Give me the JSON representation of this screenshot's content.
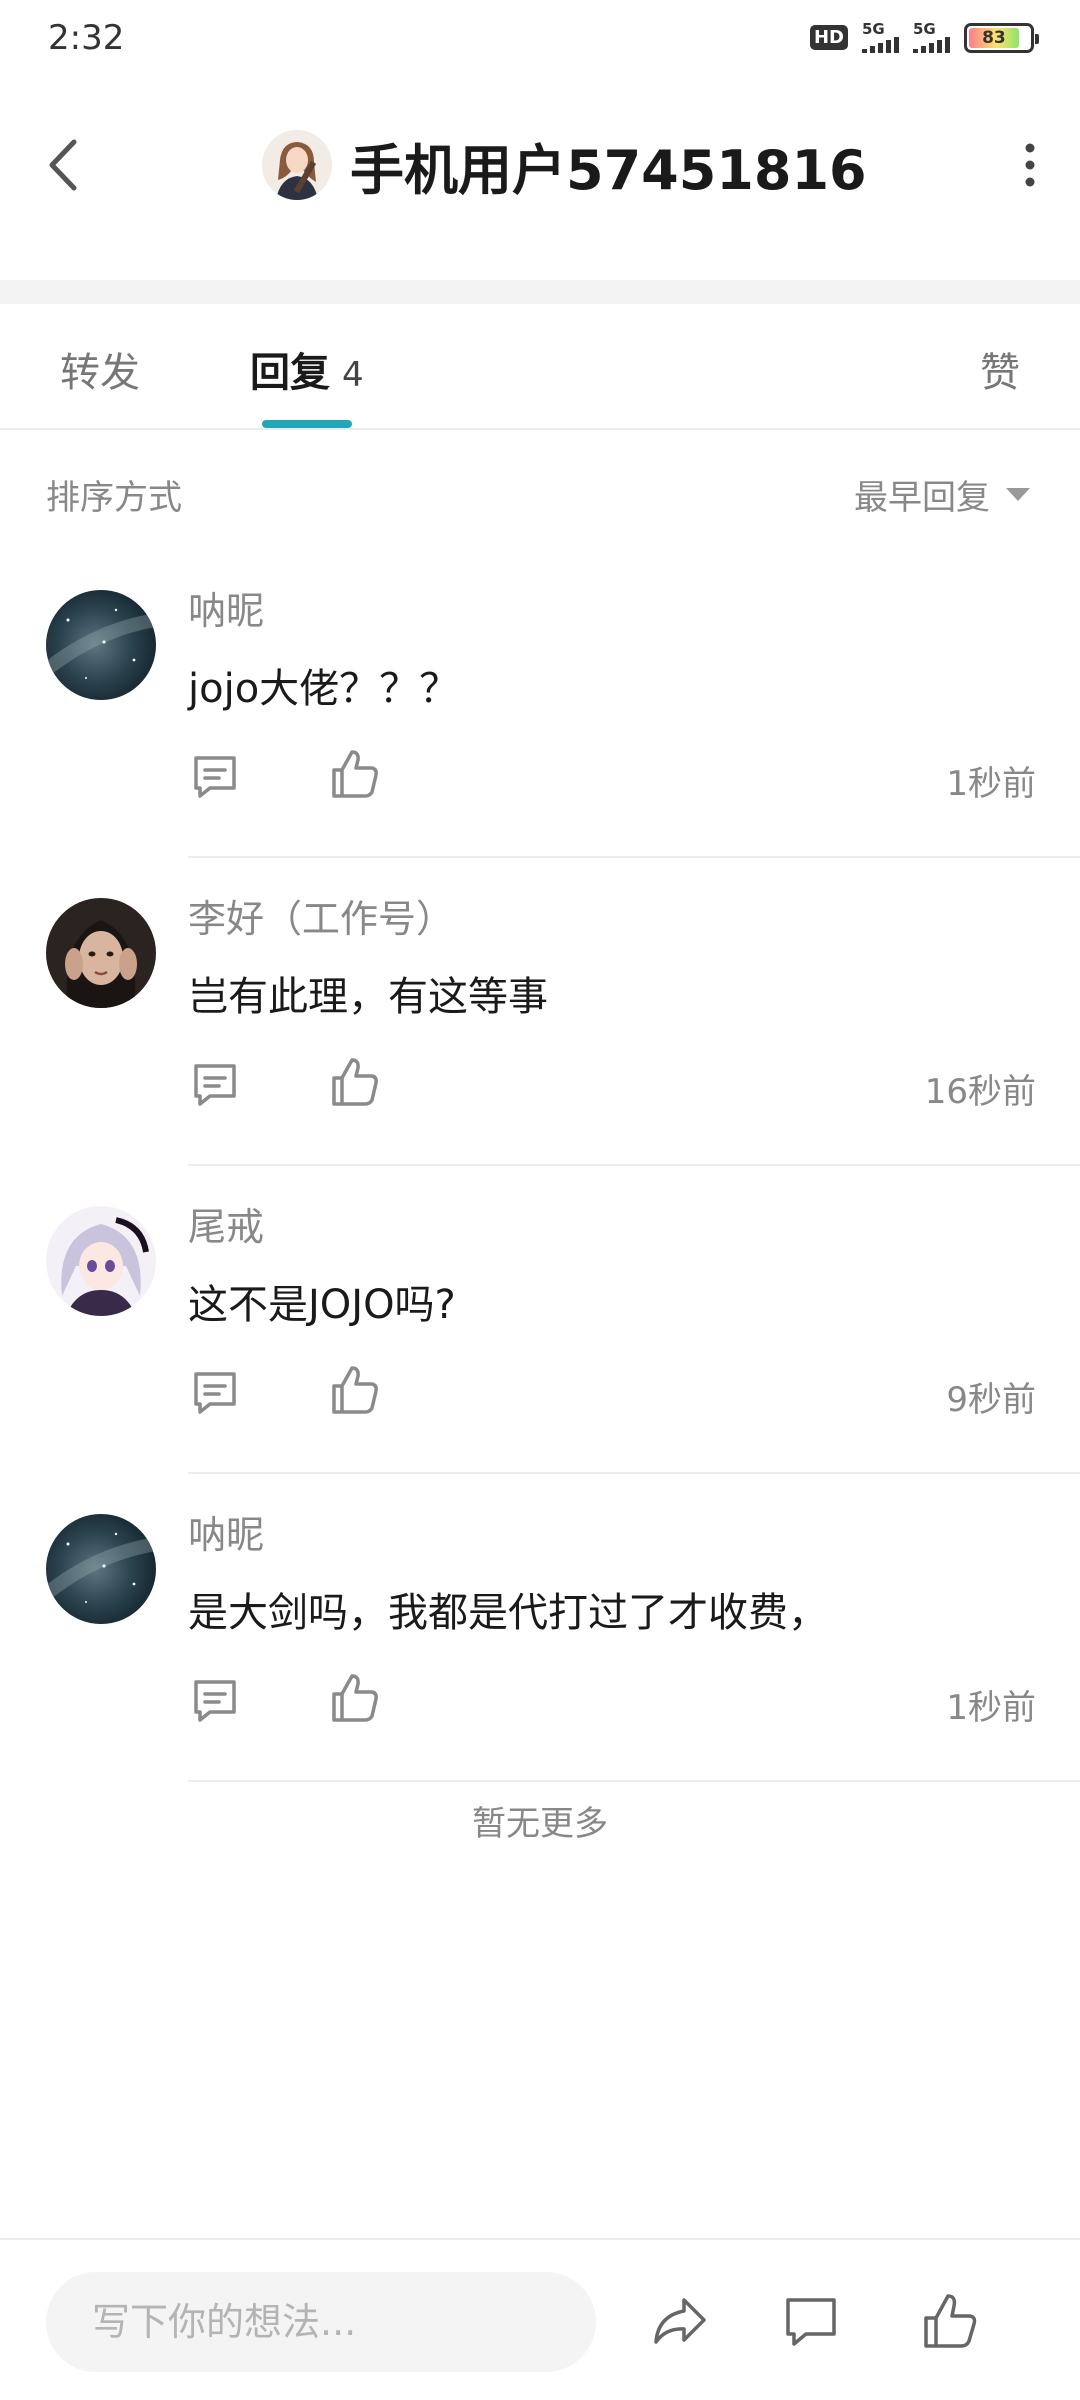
{
  "status_bar": {
    "time": "2:32",
    "hd_label": "HD",
    "signal1_label": "5G",
    "signal2_label": "5G",
    "battery_level": "83"
  },
  "header": {
    "title": "手机用户57451816",
    "back_icon": "chevron-left-icon",
    "more_icon": "vertical-dots-icon"
  },
  "tabs": {
    "forward": "转发",
    "reply": "回复",
    "reply_count": "4",
    "like": "赞",
    "active": "reply",
    "accent_color": "#20a8b8"
  },
  "sort": {
    "label": "排序方式",
    "selected": "最早回复"
  },
  "comments": [
    {
      "name": "呐昵",
      "text": "jojo大佬？？？",
      "time": "1秒前",
      "avatar": "galaxy-avatar"
    },
    {
      "name": "李好（工作号）",
      "text": "岂有此理，有这等事",
      "time": "16秒前",
      "avatar": "girl-photo-avatar"
    },
    {
      "name": "尾戒",
      "text": "这不是JOJO吗?",
      "time": "9秒前",
      "avatar": "anime-girl-avatar"
    },
    {
      "name": "呐昵",
      "text": "是大剑吗，我都是代打过了才收费，",
      "time": "1秒前",
      "avatar": "galaxy-avatar"
    }
  ],
  "no_more": "暂无更多",
  "bottom_bar": {
    "input_placeholder": "写下你的想法..."
  }
}
